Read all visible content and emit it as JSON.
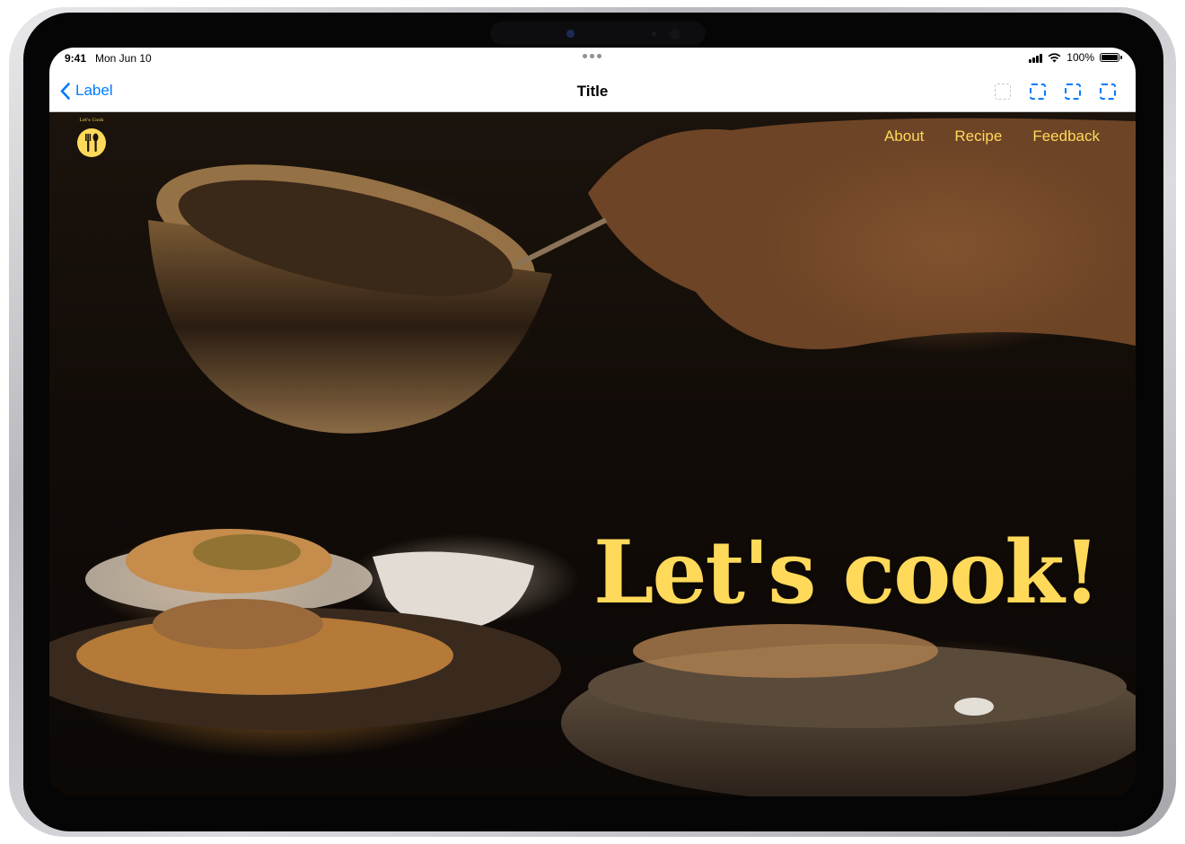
{
  "status_bar": {
    "time": "9:41",
    "date": "Mon Jun 10",
    "battery_percent": "100%",
    "battery_level": 1.0,
    "icons": [
      "signal-icon",
      "wifi-icon",
      "battery-icon"
    ]
  },
  "nav_bar": {
    "back_label": "Label",
    "back_icon": "chevron-left-icon",
    "title": "Title",
    "toolbar_icons": [
      {
        "name": "placeholder-icon",
        "enabled": false
      },
      {
        "name": "placeholder-icon",
        "enabled": true
      },
      {
        "name": "placeholder-icon",
        "enabled": true
      },
      {
        "name": "placeholder-icon",
        "enabled": true
      }
    ]
  },
  "site": {
    "logo_text": "Let's Cook",
    "logo_icon": "fork-spoon-icon",
    "nav": [
      "About",
      "Recipe",
      "Feedback"
    ],
    "headline": "Let's cook!"
  },
  "colors": {
    "accent": "#ffd95a",
    "ios_blue": "#007aff",
    "background": "#120c08"
  }
}
